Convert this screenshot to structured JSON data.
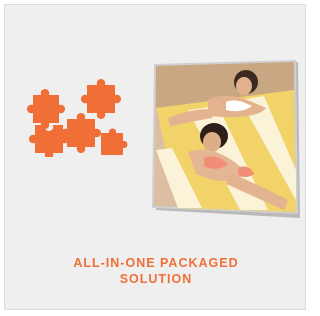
{
  "feature": {
    "caption_line1": "ALL-IN-ONE PACKAGED",
    "caption_line2": "SOLUTION"
  },
  "icons": {
    "main_icon": "puzzle-pieces-icon",
    "photo": "photo-canvas-print"
  },
  "colors": {
    "accent": "#ef6f37",
    "background": "#efefef",
    "border": "#dcdcdc"
  }
}
